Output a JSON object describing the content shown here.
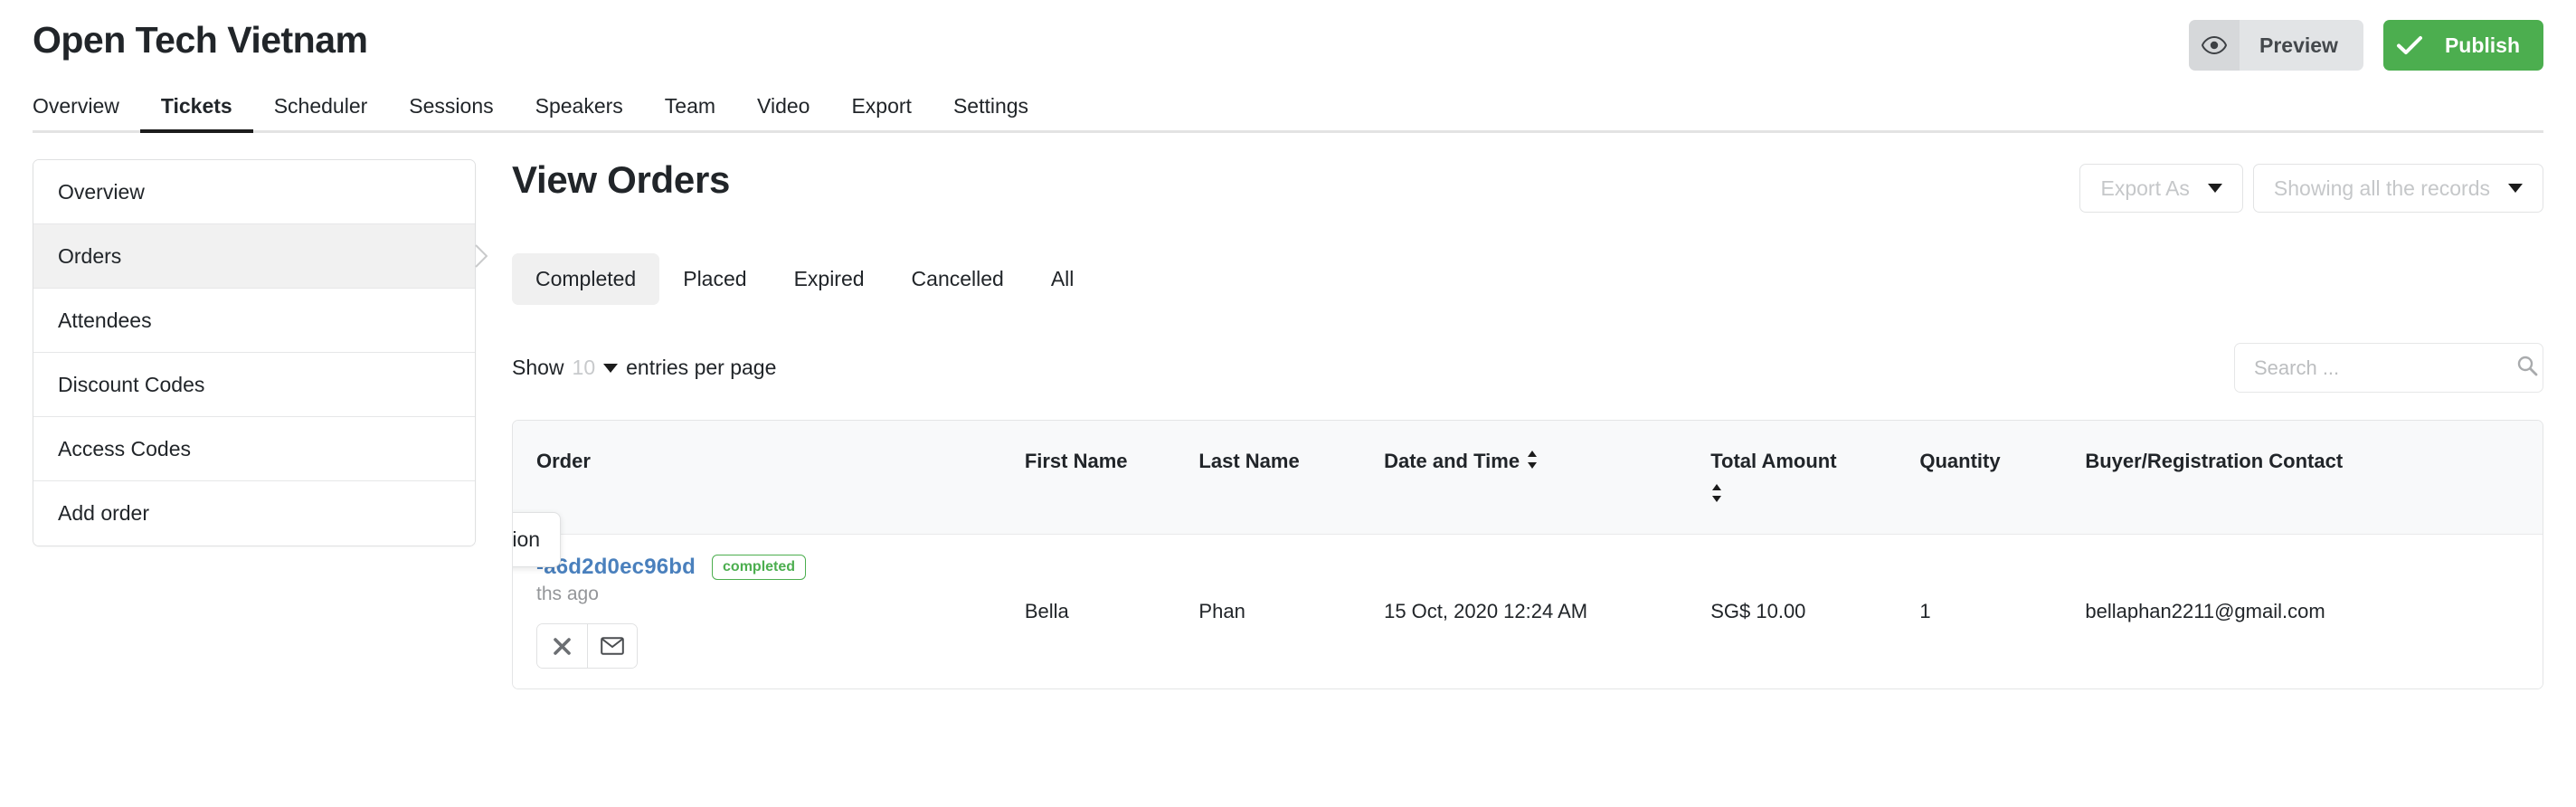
{
  "header": {
    "event_title": "Open Tech Vietnam",
    "preview_label": "Preview",
    "preview_icon": "eye-icon",
    "publish_label": "Publish",
    "publish_icon": "check-icon",
    "publish_color": "#4cae4f"
  },
  "nav": {
    "tabs": [
      {
        "label": "Overview",
        "active": false
      },
      {
        "label": "Tickets",
        "active": true
      },
      {
        "label": "Scheduler",
        "active": false
      },
      {
        "label": "Sessions",
        "active": false
      },
      {
        "label": "Speakers",
        "active": false
      },
      {
        "label": "Team",
        "active": false
      },
      {
        "label": "Video",
        "active": false
      },
      {
        "label": "Export",
        "active": false
      },
      {
        "label": "Settings",
        "active": false
      }
    ]
  },
  "sidebar": {
    "items": [
      {
        "label": "Overview",
        "active": false
      },
      {
        "label": "Orders",
        "active": true
      },
      {
        "label": "Attendees",
        "active": false
      },
      {
        "label": "Discount Codes",
        "active": false
      },
      {
        "label": "Access Codes",
        "active": false
      },
      {
        "label": "Add order",
        "active": false
      }
    ]
  },
  "main": {
    "page_title": "View Orders",
    "export_as": {
      "label": "Export As",
      "icon": "chevron-down-icon"
    },
    "records_filter": {
      "label": "Showing all the records",
      "icon": "chevron-down-icon"
    },
    "filters": [
      {
        "label": "Completed",
        "active": true
      },
      {
        "label": "Placed",
        "active": false
      },
      {
        "label": "Expired",
        "active": false
      },
      {
        "label": "Cancelled",
        "active": false
      },
      {
        "label": "All",
        "active": false
      }
    ],
    "show_entries": {
      "prefix": "Show",
      "count": "10",
      "suffix": "entries per page"
    },
    "search": {
      "placeholder": "Search ...",
      "value": "",
      "icon": "search-icon"
    },
    "table": {
      "columns": [
        {
          "label": "Order",
          "sortable": false
        },
        {
          "label": "First Name",
          "sortable": false
        },
        {
          "label": "Last Name",
          "sortable": false
        },
        {
          "label": "Date and Time",
          "sortable": true
        },
        {
          "label": "Total Amount",
          "sortable": true
        },
        {
          "label": "Quantity",
          "sortable": false
        },
        {
          "label": "Buyer/Registration Contact",
          "sortable": false
        }
      ],
      "rows": [
        {
          "order_id": "-a6d2d0ec96bd",
          "status_badge": "completed",
          "status_color": "#4cae4f",
          "time_ago": "ths ago",
          "first_name": "Bella",
          "last_name": "Phan",
          "date_time": "15 Oct, 2020 12:24 AM",
          "total_amount": "SG$ 10.00",
          "quantity": "1",
          "buyer_contact": "bellaphan2211@gmail.com",
          "actions": [
            {
              "icon": "cancel-x-icon",
              "name": "cancel-order-button"
            },
            {
              "icon": "envelope-icon",
              "name": "resend-confirmation-button"
            }
          ]
        }
      ]
    },
    "tooltip": {
      "text": "Resend order confirmation"
    }
  }
}
